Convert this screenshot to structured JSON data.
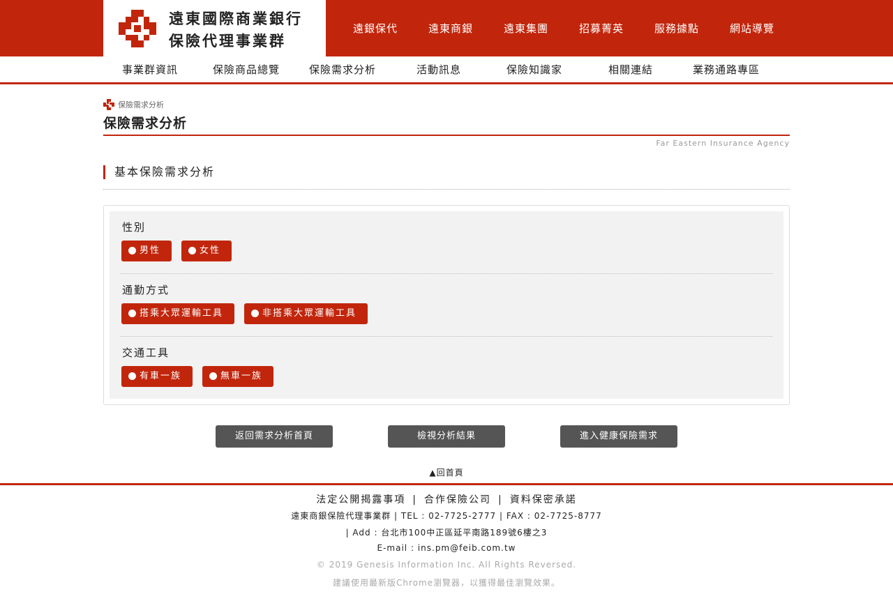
{
  "header": {
    "logo_line1": "遠東國際商業銀行",
    "logo_line2": "保險代理事業群",
    "nav": [
      "遠銀保代",
      "遠東商銀",
      "遠東集團",
      "招募菁英",
      "服務據點",
      "網站導覽"
    ]
  },
  "subnav": [
    "事業群資訊",
    "保險商品總覽",
    "保險需求分析",
    "活動訊息",
    "保險知識家",
    "相關連結",
    "業務通路專區"
  ],
  "breadcrumb": "保險需求分析",
  "page_title": "保險需求分析",
  "brand_en": "Far Eastern Insurance Agency",
  "section_title": "基本保險需求分析",
  "form": {
    "gender_label": "性別",
    "gender_options": [
      "男性",
      "女性"
    ],
    "commute_label": "通勤方式",
    "commute_options": [
      "搭乘大眾運輸工具",
      "非搭乘大眾運輸工具"
    ],
    "vehicle_label": "交通工具",
    "vehicle_options": [
      "有車一族",
      "無車一族"
    ]
  },
  "buttons": {
    "back": "返回需求分析首頁",
    "result": "檢視分析結果",
    "health": "進入健康保險需求"
  },
  "back_to_top": "▲回首頁",
  "footer": {
    "links": [
      "法定公開揭露事項",
      "合作保險公司",
      "資料保密承諾"
    ],
    "separator": "|",
    "line1": "遠東商銀保險代理事業群 | TEL : 02-7725-2777 | FAX : 02-7725-8777",
    "line2": "| Add : 台北市100中正區延平南路189號6樓之3",
    "line3": "E-mail : ins.pm@feib.com.tw",
    "copyright": "© 2019 Genesis Information Inc. All Rights Reversed.",
    "browser_note": "建議使用最新版Chrome瀏覽器，以獲得最佳瀏覽效果。"
  },
  "colors": {
    "brand_red": "#c1260c",
    "button_gray": "#555555",
    "panel_bg": "#f2f2f2"
  }
}
